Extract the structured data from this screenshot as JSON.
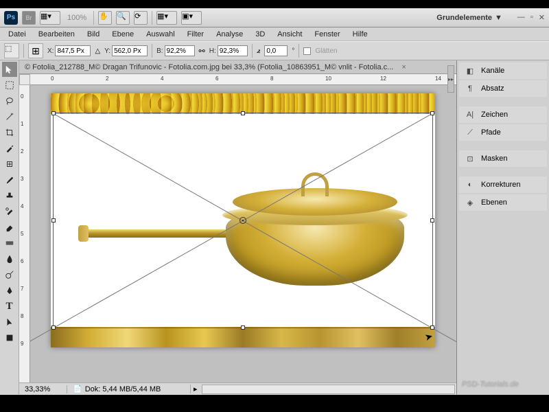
{
  "toolbar": {
    "zoom": "100%",
    "workspace": "Grundelemente"
  },
  "menu": [
    "Datei",
    "Bearbeiten",
    "Bild",
    "Ebene",
    "Auswahl",
    "Filter",
    "Analyse",
    "3D",
    "Ansicht",
    "Fenster",
    "Hilfe"
  ],
  "options": {
    "x_label": "X:",
    "x_value": "847,5 Px",
    "y_label": "Y:",
    "y_value": "562,0 Px",
    "w_label": "B:",
    "w_value": "92,2%",
    "h_label": "H:",
    "h_value": "92,3%",
    "angle_value": "0,0",
    "angle_unit": "°",
    "smooth": "Glätten"
  },
  "document": {
    "tab_title": "© Fotolia_212788_M© Dragan Trifunovic - Fotolia.com.jpg bei 33,3% (Fotolia_10863951_M© vnlit - Fotolia.c..."
  },
  "ruler_h": [
    "0",
    "2",
    "4",
    "6",
    "8",
    "10",
    "12",
    "14"
  ],
  "ruler_v": [
    "0",
    "1",
    "2",
    "3",
    "4",
    "5",
    "6",
    "7",
    "8",
    "9"
  ],
  "status": {
    "zoom": "33,33%",
    "doc_info": "Dok: 5,44 MB/5,44 MB"
  },
  "panels": [
    {
      "icon": "channels",
      "label": "Kanäle"
    },
    {
      "icon": "paragraph",
      "label": "Absatz"
    },
    {
      "sep": true
    },
    {
      "icon": "character",
      "label": "Zeichen"
    },
    {
      "icon": "paths",
      "label": "Pfade"
    },
    {
      "sep": true
    },
    {
      "icon": "masks",
      "label": "Masken"
    },
    {
      "sep": true
    },
    {
      "icon": "adjustments",
      "label": "Korrekturen"
    },
    {
      "icon": "layers",
      "label": "Ebenen"
    }
  ],
  "watermark": "PSD-Tutorials.de"
}
